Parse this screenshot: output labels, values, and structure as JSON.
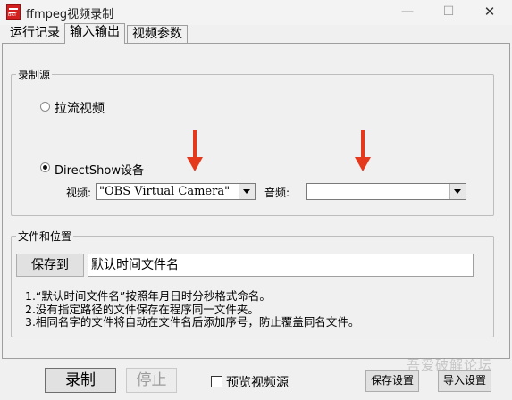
{
  "window": {
    "title": "ffmpeg视频录制",
    "min_glyph": "—",
    "max_glyph": "☐",
    "close_glyph": "✕",
    "icon": "app-icon"
  },
  "tabs": [
    {
      "label": "运行记录",
      "selected": false
    },
    {
      "label": "输入输出",
      "selected": true
    },
    {
      "label": "视频参数",
      "selected": false
    }
  ],
  "source_group": {
    "title": "录制源",
    "stream_label": "拉流视频",
    "dshow_label": "DirectShow设备",
    "selected": "DirectShow设备",
    "video_label": "视频:",
    "video_value": "\"OBS Virtual Camera\"",
    "audio_label": "音频:",
    "audio_value": ""
  },
  "file_group": {
    "title": "文件和位置",
    "save_to_label": "保存到",
    "filename_value": "默认时间文件名",
    "notes": [
      "1.“默认时间文件名”按照年月日时分秒格式命名。",
      "2.没有指定路径的文件保存在程序同一文件夹。",
      "3.相同名字的文件将自动在文件名后添加序号，防止覆盖同名文件。"
    ]
  },
  "bottom": {
    "record_label": "录制",
    "stop_label": "停止",
    "preview_label": "预览视频源",
    "preview_checked": false,
    "save_settings_label": "保存设置",
    "import_settings_label": "导入设置"
  },
  "watermark": "吾爱破解论坛",
  "colors": {
    "annotation_arrow": "#e5391e",
    "app_icon": "#d22020"
  }
}
